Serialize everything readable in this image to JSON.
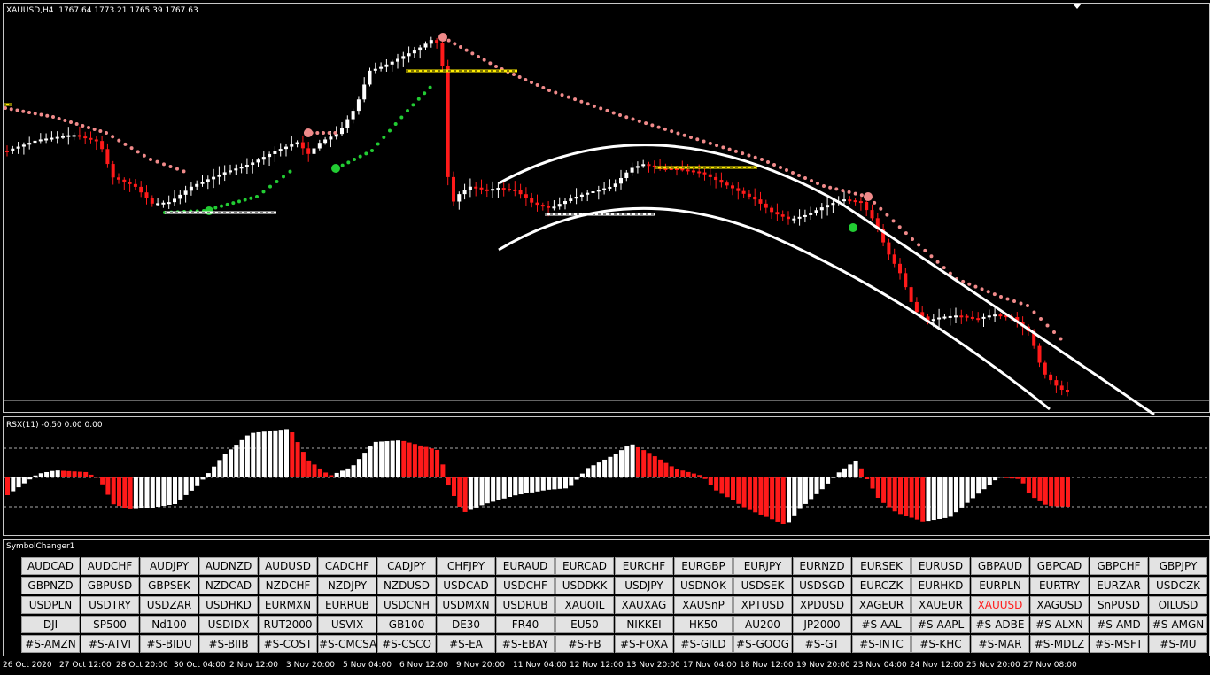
{
  "main_chart": {
    "title": "XAUUSD,H4  1767.64 1773.21 1765.39 1767.63"
  },
  "subwindow": {
    "title": "RSX(11) -0.50 0.00 0.00"
  },
  "symbol_panel": {
    "title": "SymbolChanger1",
    "active_symbol": "XAUUSD",
    "rows": [
      [
        "AUDCAD",
        "AUDCHF",
        "AUDJPY",
        "AUDNZD",
        "AUDUSD",
        "CADCHF",
        "CADJPY",
        "CHFJPY",
        "EURAUD",
        "EURCAD",
        "EURCHF",
        "EURGBP",
        "EURJPY",
        "EURNZD",
        "EURSEK",
        "EURUSD",
        "GBPAUD",
        "GBPCAD",
        "GBPCHF",
        "GBPJPY"
      ],
      [
        "GBPNZD",
        "GBPUSD",
        "GBPSEK",
        "NZDCAD",
        "NZDCHF",
        "NZDJPY",
        "NZDUSD",
        "USDCAD",
        "USDCHF",
        "USDDKK",
        "USDJPY",
        "USDNOK",
        "USDSEK",
        "USDSGD",
        "EURCZK",
        "EURHKD",
        "EURPLN",
        "EURTRY",
        "EURZAR",
        "USDCZK"
      ],
      [
        "USDPLN",
        "USDTRY",
        "USDZAR",
        "USDHKD",
        "EURMXN",
        "EURRUB",
        "USDCNH",
        "USDMXN",
        "USDRUB",
        "XAUOIL",
        "XAUXAG",
        "XAUSnP",
        "XPTUSD",
        "XPDUSD",
        "XAGEUR",
        "XAUEUR",
        "XAUUSD",
        "XAGUSD",
        "SnPUSD",
        "OILUSD"
      ],
      [
        "DJI",
        "SP500",
        "Nd100",
        "USDIDX",
        "RUT2000",
        "USVIX",
        "GB100",
        "DE30",
        "FR40",
        "EU50",
        "NIKKEI",
        "HK50",
        "AU200",
        "JP2000",
        "#S-AAL",
        "#S-AAPL",
        "#S-ADBE",
        "#S-ALXN",
        "#S-AMD",
        "#S-AMGN"
      ],
      [
        "#S-AMZN",
        "#S-ATVI",
        "#S-BIDU",
        "#S-BIIB",
        "#S-COST",
        "#S-CMCSA",
        "#S-CSCO",
        "#S-EA",
        "#S-EBAY",
        "#S-FB",
        "#S-FOXA",
        "#S-GILD",
        "#S-GOOG",
        "#S-GT",
        "#S-INTC",
        "#S-KHC",
        "#S-MAR",
        "#S-MDLZ",
        "#S-MSFT",
        "#S-MU"
      ]
    ]
  },
  "time_axis": {
    "labels": [
      "26 Oct 2020",
      "27 Oct 12:00",
      "28 Oct 20:00",
      "30 Oct 04:00",
      "2 Nov 12:00",
      "3 Nov 20:00",
      "5 Nov 04:00",
      "6 Nov 12:00",
      "9 Nov 20:00",
      "11 Nov 04:00",
      "12 Nov 12:00",
      "13 Nov 20:00",
      "17 Nov 04:00",
      "18 Nov 12:00",
      "19 Nov 20:00",
      "23 Nov 04:00",
      "24 Nov 12:00",
      "25 Nov 20:00",
      "27 Nov 08:00"
    ]
  },
  "colors": {
    "background": "#000000",
    "bull_candle": "#ffffff",
    "bear_candle": "#ff1a1a",
    "trail_down_dots": "#f08a8a",
    "trail_up_dots": "#22cc33",
    "level_yellow": "#ffee00",
    "level_white": "#ffffff",
    "channel_lines": "#ffffff",
    "active_symbol": "#ff1c1c"
  }
}
